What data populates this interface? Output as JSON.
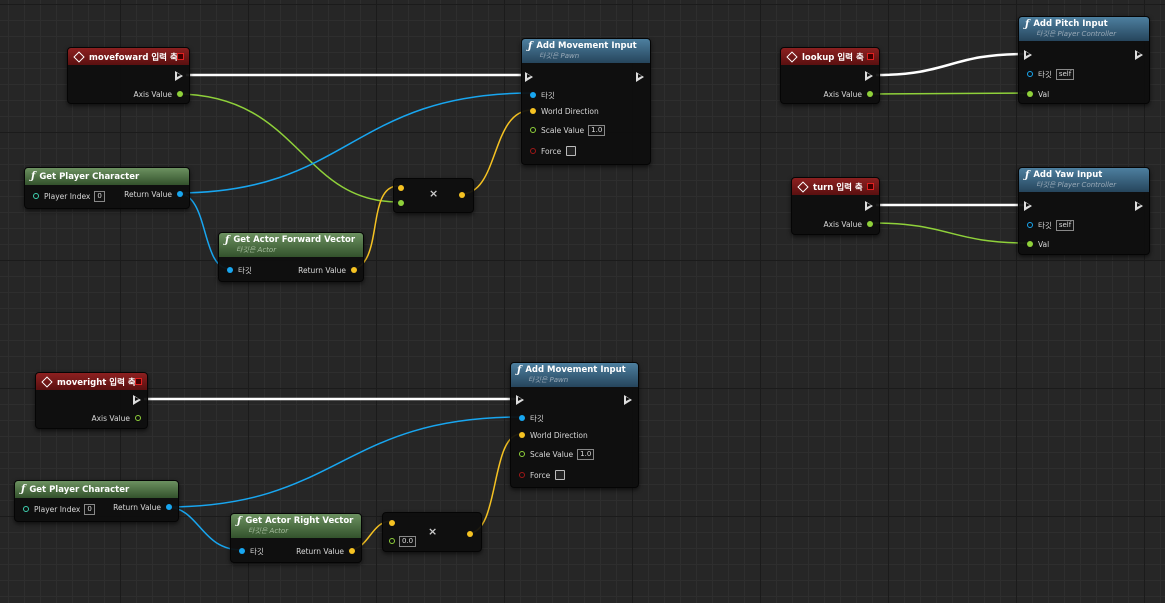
{
  "nodes": {
    "movefoward": {
      "title": "movefoward 입력 축",
      "axis_label": "Axis Value"
    },
    "add_move1": {
      "title": "Add Movement Input",
      "subtitle": "타깃은 Pawn",
      "target": "타깃",
      "world_dir": "World Direction",
      "scale": "Scale Value",
      "scale_val": "1.0",
      "force": "Force"
    },
    "getpc1": {
      "title": "Get Player Character",
      "player_index": "Player Index",
      "index_val": "0",
      "return": "Return Value"
    },
    "fwd_vec": {
      "title": "Get Actor Forward Vector",
      "subtitle": "타깃은 Actor",
      "target": "타깃",
      "return": "Return Value"
    },
    "mult1": {
      "symbol": "×"
    },
    "lookup": {
      "title": "lookup 입력 축",
      "axis_label": "Axis Value"
    },
    "pitch": {
      "title": "Add Pitch Input",
      "subtitle": "타깃은 Player Controller",
      "target": "타깃",
      "self": "self",
      "val": "Val"
    },
    "turn": {
      "title": "turn 입력 축",
      "axis_label": "Axis Value"
    },
    "yaw": {
      "title": "Add Yaw Input",
      "subtitle": "타깃은 Player Controller",
      "target": "타깃",
      "self": "self",
      "val": "Val"
    },
    "moveright": {
      "title": "moveright 입력 축",
      "axis_label": "Axis Value"
    },
    "add_move2": {
      "title": "Add Movement Input",
      "subtitle": "타깃은 Pawn",
      "target": "타깃",
      "world_dir": "World Direction",
      "scale": "Scale Value",
      "scale_val": "1.0",
      "force": "Force"
    },
    "getpc2": {
      "title": "Get Player Character",
      "player_index": "Player Index",
      "index_val": "0",
      "return": "Return Value"
    },
    "right_vec": {
      "title": "Get Actor Right Vector",
      "subtitle": "타깃은 Actor",
      "target": "타깃",
      "return": "Return Value"
    },
    "mult2": {
      "symbol": "×",
      "b_val": "0.0"
    }
  },
  "colors": {
    "exec_wire": "#ffffff",
    "float_wire": "#8fd13a",
    "object_wire": "#18a6f0",
    "vector_wire": "#f5c222",
    "event_header": "#8c2020",
    "function_header": "#4d7f9f",
    "pure_header": "#6c9160"
  }
}
